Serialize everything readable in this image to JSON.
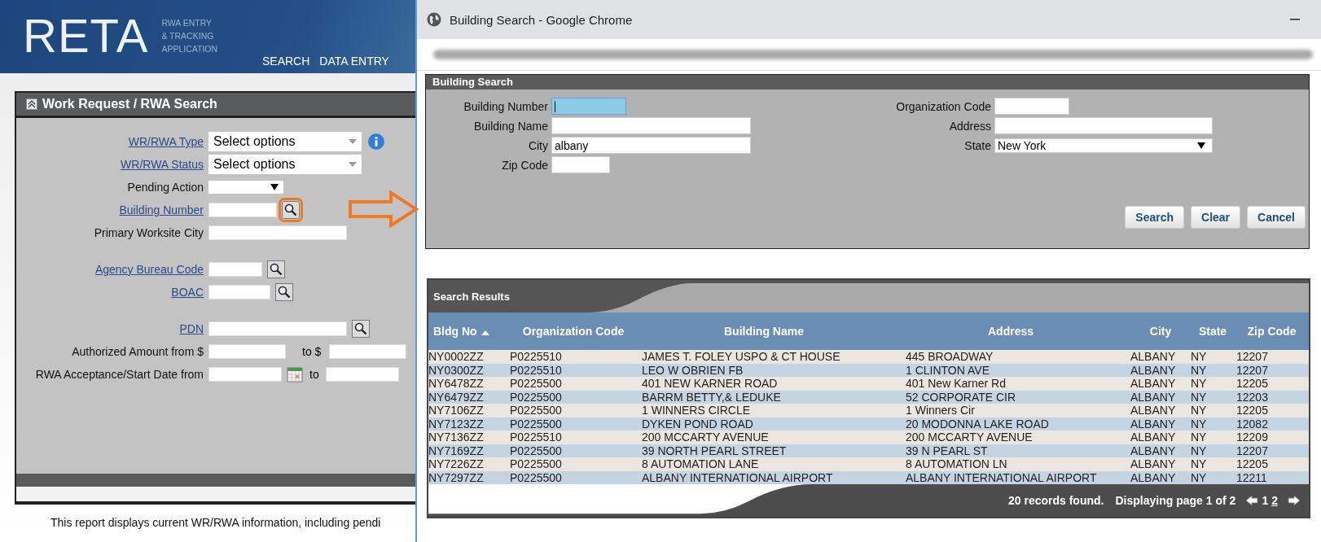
{
  "app": {
    "logo": "RETA",
    "subtitle": [
      "RWA ENTRY",
      "& TRACKING",
      "APPLICATION"
    ],
    "nav": [
      "SEARCH",
      "DATA ENTRY"
    ]
  },
  "panel": {
    "title": "Work Request / RWA Search",
    "groups": [
      [
        {
          "label": "WR/RWA Type",
          "link": true,
          "kind": "multiselect",
          "value": "Select options",
          "info": true
        },
        {
          "label": "WR/RWA Status",
          "link": true,
          "kind": "multiselect",
          "value": "Select options",
          "info": false
        },
        {
          "label": "Pending Action",
          "link": false,
          "kind": "dropdown"
        },
        {
          "label": "Building Number",
          "link": true,
          "kind": "lookup",
          "highlighted": true
        },
        {
          "label": "Primary Worksite City",
          "link": false,
          "kind": "text"
        }
      ],
      [
        {
          "label": "Agency Bureau Code",
          "link": true,
          "kind": "lookup",
          "highlighted": false
        },
        {
          "label": "BOAC",
          "link": true,
          "kind": "lookup",
          "highlighted": false
        }
      ],
      [
        {
          "label": "PDN",
          "link": true,
          "kind": "lookup",
          "highlighted": false
        },
        {
          "label": "Authorized Amount from $",
          "link": false,
          "kind": "range",
          "to_label": "to $"
        },
        {
          "label": "RWA Acceptance/Start Date  from",
          "link": false,
          "kind": "date_range",
          "to_label": "to"
        }
      ]
    ]
  },
  "footer_text": "This report displays current WR/RWA information, including pendi",
  "popup": {
    "window_title": "Building Search - Google Chrome",
    "search_form": {
      "title": "Building Search",
      "left_fields": [
        {
          "label": "Building Number",
          "focused": true
        },
        {
          "label": "Building Name",
          "focused": false
        },
        {
          "label": "City",
          "value": "albany",
          "focused": false
        },
        {
          "label": "Zip Code",
          "focused": false
        }
      ],
      "right_fields": [
        {
          "label": "Organization Code",
          "kind": "text"
        },
        {
          "label": "Address",
          "kind": "text"
        },
        {
          "label": "State",
          "kind": "dropdown",
          "value": "New York"
        }
      ],
      "buttons": [
        "Search",
        "Clear",
        "Cancel"
      ]
    },
    "results": {
      "title": "Search Results",
      "columns": [
        {
          "label": "Bldg No",
          "sorted": true
        },
        {
          "label": "Organization Code",
          "sorted": false
        },
        {
          "label": "Building Name",
          "sorted": false
        },
        {
          "label": "Address",
          "sorted": false
        },
        {
          "label": "City",
          "sorted": false
        },
        {
          "label": "State",
          "sorted": false
        },
        {
          "label": "Zip Code",
          "sorted": false
        }
      ],
      "rows": [
        [
          "NY0002ZZ",
          "P0225510",
          "JAMES T. FOLEY USPO & CT HOUSE",
          "445 BROADWAY",
          "ALBANY",
          "NY",
          "12207"
        ],
        [
          "NY0300ZZ",
          "P0225510",
          "LEO W OBRIEN FB",
          "1 CLINTON AVE",
          "ALBANY",
          "NY",
          "12207"
        ],
        [
          "NY6478ZZ",
          "P0225500",
          "401 NEW KARNER ROAD",
          "401 New Karner Rd",
          "ALBANY",
          "NY",
          "12205"
        ],
        [
          "NY6479ZZ",
          "P0225500",
          "BARRM BETTY,& LEDUKE",
          "52 CORPORATE CIR",
          "ALBANY",
          "NY",
          "12203"
        ],
        [
          "NY7106ZZ",
          "P0225500",
          "1 WINNERS CIRCLE",
          "1 Winners Cir",
          "ALBANY",
          "NY",
          "12205"
        ],
        [
          "NY7123ZZ",
          "P0225500",
          "DYKEN POND ROAD",
          "20 MODONNA LAKE ROAD",
          "ALBANY",
          "NY",
          "12082"
        ],
        [
          "NY7136ZZ",
          "P0225510",
          "200 MCCARTY AVENUE",
          "200 MCCARTY AVENUE",
          "ALBANY",
          "NY",
          "12209"
        ],
        [
          "NY7169ZZ",
          "P0225500",
          "39 NORTH PEARL STREET",
          "39 N PEARL ST",
          "ALBANY",
          "NY",
          "12207"
        ],
        [
          "NY7226ZZ",
          "P0225500",
          "8 AUTOMATION LANE",
          "8 AUTOMATION LN",
          "ALBANY",
          "NY",
          "12205"
        ],
        [
          "NY7297ZZ",
          "P0225500",
          "ALBANY INTERNATIONAL AIRPORT",
          "ALBANY INTERNATIONAL AIRPORT",
          "ALBANY",
          "NY",
          "12211"
        ]
      ],
      "count": "20",
      "count_label": "records found.",
      "page_label": "Displaying page",
      "page_of": "1 of 2",
      "pages": [
        {
          "label": "1",
          "selected": true
        },
        {
          "label": "2",
          "selected": false
        }
      ]
    }
  }
}
